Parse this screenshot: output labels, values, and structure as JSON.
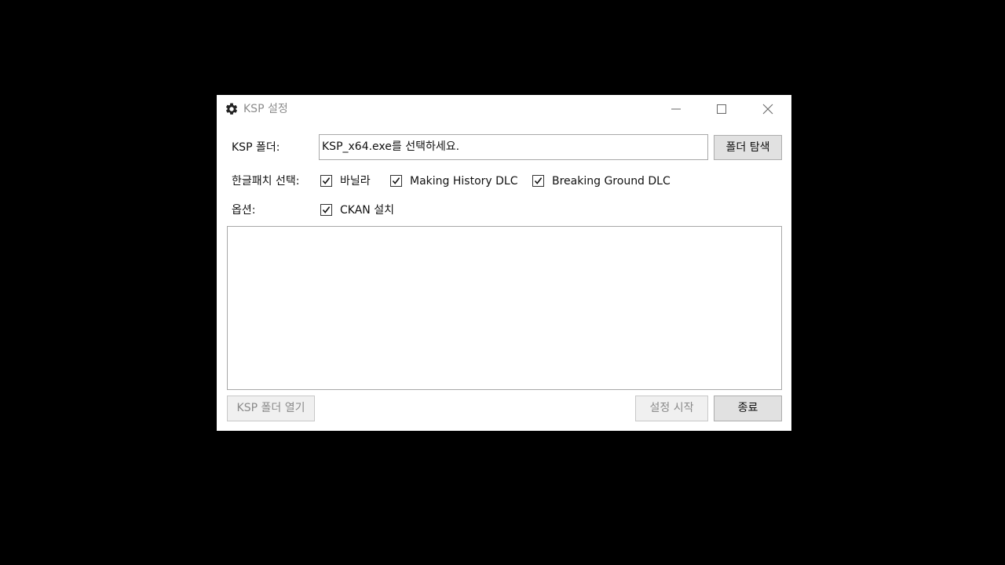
{
  "window": {
    "title": "KSP 설정",
    "title_icon": "gear-icon",
    "controls": {
      "minimize_icon": "minimize-icon",
      "maximize_icon": "maximize-icon",
      "close_icon": "close-icon"
    }
  },
  "folder_row": {
    "label": "KSP 폴더:",
    "input_value": "KSP_x64.exe를 선택하세요.",
    "browse_button": "폴더 탐색"
  },
  "patch_row": {
    "label": "한글패치 선택:",
    "options": [
      {
        "label": "바닐라",
        "checked": true
      },
      {
        "label": "Making History DLC",
        "checked": true
      },
      {
        "label": "Breaking Ground DLC",
        "checked": true
      }
    ]
  },
  "options_row": {
    "label": "옵션:",
    "options": [
      {
        "label": "CKAN 설치",
        "checked": true
      }
    ]
  },
  "log": {
    "content": ""
  },
  "footer": {
    "open_folder_button": "KSP 폴더 열기",
    "start_button": "설정 시작",
    "exit_button": "종료"
  },
  "colors": {
    "background": "#000000",
    "window": "#ffffff",
    "disabled_text": "#8a8a8a",
    "button_face": "#e1e1e1"
  }
}
